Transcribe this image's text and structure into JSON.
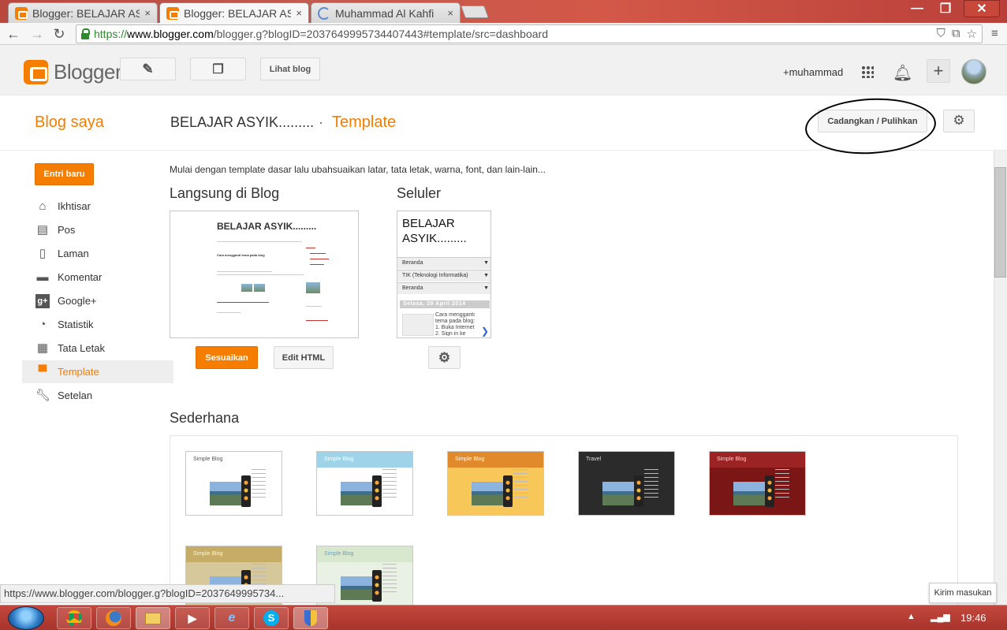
{
  "browser": {
    "tabs": [
      {
        "title": "Blogger: BELAJAR AS",
        "state": "inactive"
      },
      {
        "title": "Blogger: BELAJAR AS",
        "state": "active"
      },
      {
        "title": "Muhammad Al Kahfi",
        "state": "loading"
      }
    ],
    "tab_close": "×",
    "url_scheme": "https://",
    "url_host": "www.blogger.com",
    "url_path": "/blogger.g?blogID=2037649995734407443#template/src=dashboard",
    "window_controls": {
      "minimize": "—",
      "maximize": "❐",
      "close": "✕"
    }
  },
  "header": {
    "logo_text": "Blogger",
    "view_blog": "Lihat blog",
    "user": "+muhammad"
  },
  "subheader": {
    "blog_saya": "Blog saya",
    "blog_name": "BELAJAR ASYIK.........",
    "separator": "·",
    "page_title": "Template",
    "backup_button": "Cadangkan / Pulihkan"
  },
  "sidebar": {
    "new_post": "Entri baru",
    "items": [
      {
        "label": "Ikhtisar",
        "icon": "home-icon"
      },
      {
        "label": "Pos",
        "icon": "posts-icon"
      },
      {
        "label": "Laman",
        "icon": "page-icon"
      },
      {
        "label": "Komentar",
        "icon": "comment-icon"
      },
      {
        "label": "Google+",
        "icon": "google-plus-icon"
      },
      {
        "label": "Statistik",
        "icon": "stats-icon"
      },
      {
        "label": "Tata Letak",
        "icon": "layout-icon"
      },
      {
        "label": "Template",
        "icon": "template-icon",
        "active": true
      },
      {
        "label": "Setelan",
        "icon": "wrench-icon"
      }
    ]
  },
  "main": {
    "intro": "Mulai dengan template dasar lalu ubahsuaikan latar, tata letak, warna, font, dan lain-lain...",
    "live_title": "Langsung di Blog",
    "mobile_title": "Seluler",
    "customize_button": "Sesuaikan",
    "edit_html_button": "Edit HTML",
    "desktop_preview_title": "BELAJAR ASYIK.........",
    "desktop_preview_post": "Cara mengganti tema pada blog",
    "mobile_preview": {
      "title": "BELAJAR ASYIK.........",
      "rows": [
        "Beranda",
        "TIK (Teknologi Informatika)",
        "Beranda"
      ],
      "date": "Selasa, 29 April 2014",
      "snippet": "Cara mengganti tema pada blog: 1. Buka Internet 2. Sign in ke blog"
    },
    "simple_title": "Sederhana",
    "themes": [
      {
        "title": "Simple Blog",
        "bg": "#ffffff",
        "head": "#ffffff",
        "title_color": "#555555"
      },
      {
        "title": "Simple Blog",
        "bg": "#ffffff",
        "head": "#9fd3ea",
        "title_color": "#ffffff"
      },
      {
        "title": "Simple Blog",
        "bg": "#f7c75a",
        "head": "#e08a2c",
        "title_color": "#ffffff"
      },
      {
        "title": "Travel",
        "bg": "#2b2b2b",
        "head": "#2b2b2b",
        "title_color": "#dddddd"
      },
      {
        "title": "Simple Blog",
        "bg": "#7a1616",
        "head": "#9c2323",
        "title_color": "#f3d2d2"
      },
      {
        "title": "Simple Blog",
        "bg": "#d7c89c",
        "head": "#c5ad68",
        "title_color": "#fff6d8"
      },
      {
        "title": "Simple Blog",
        "bg": "#e9f1e4",
        "head": "#d8e8cf",
        "title_color": "#6aa0c7"
      }
    ]
  },
  "status": {
    "hover_url": "https://www.blogger.com/blogger.g?blogID=2037649995734...",
    "feedback": "Kirim masukan",
    "clock": "19:46"
  },
  "colors": {
    "accent": "#f57d00"
  }
}
